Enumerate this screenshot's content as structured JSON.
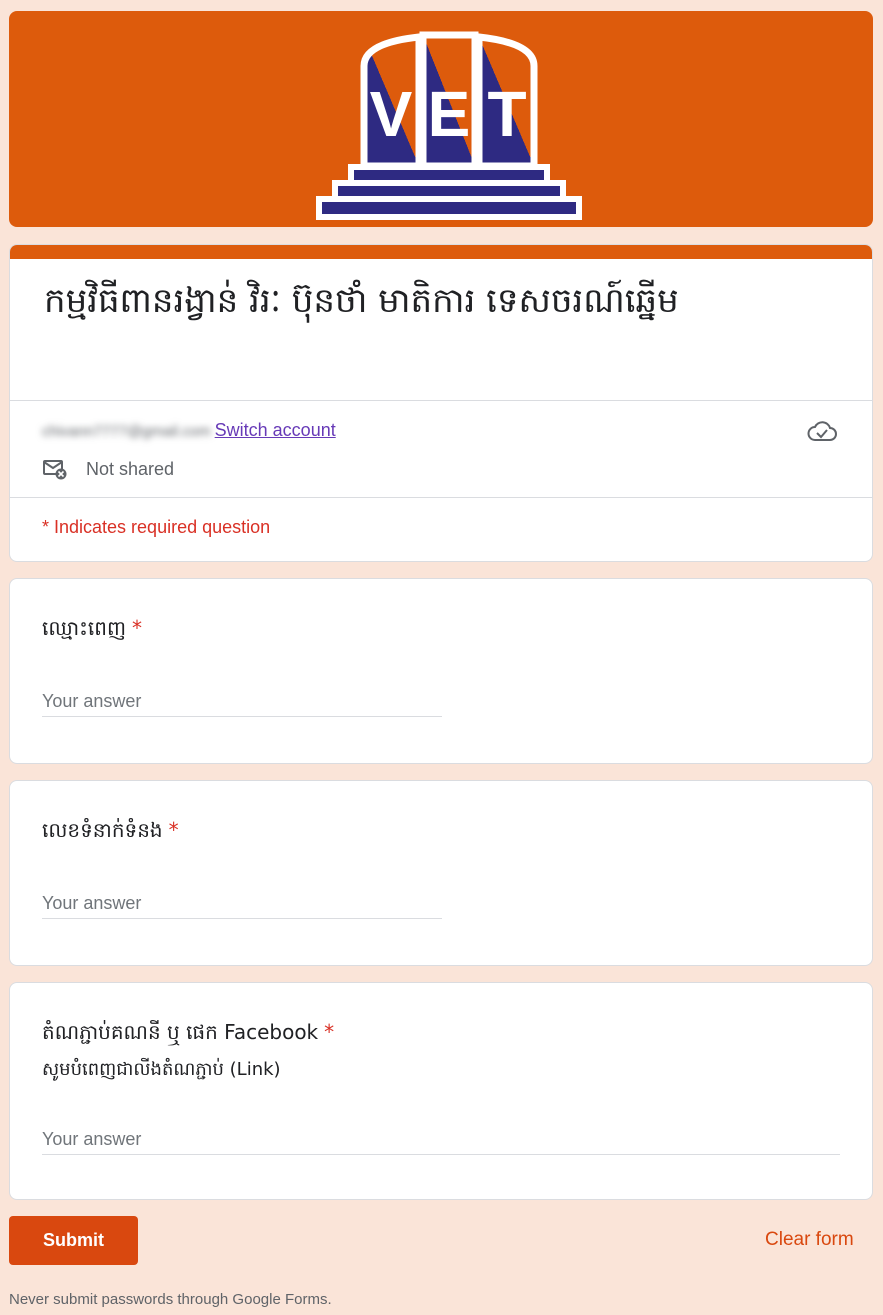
{
  "banner": {
    "logo_letters": [
      "V",
      "E",
      "T"
    ],
    "color": "#dd5b0c"
  },
  "form": {
    "title": "កម្មវិធីពានរង្វាន់ វិរៈ ប៊ុនថាំ មាតិការ ទេសចរណ៍ឆ្នើម",
    "account_email": "chivann7777@gmail.com",
    "switch_account": "Switch account",
    "not_shared": "Not shared",
    "required_note": "* Indicates required question"
  },
  "questions": [
    {
      "label": "ឈ្មោះពេញ",
      "required_mark": "*",
      "placeholder": "Your answer"
    },
    {
      "label": "លេខទំនាក់ទំនង",
      "required_mark": "*",
      "placeholder": "Your answer"
    },
    {
      "label": "តំណភ្ជាប់គណនី ឬ ផេក Facebook",
      "required_mark": "*",
      "description": "សូមបំពេញជាលីងតំណភ្ជាប់ (Link)",
      "placeholder": "Your answer"
    }
  ],
  "actions": {
    "submit": "Submit",
    "clear": "Clear form"
  },
  "footer": "Never submit passwords through Google Forms.",
  "colors": {
    "accent": "#dd5b0c",
    "submit": "#d9480f",
    "background": "#fae4d8",
    "required": "#d93025",
    "link": "#673ab7",
    "logo_blue": "#2e2a82"
  }
}
